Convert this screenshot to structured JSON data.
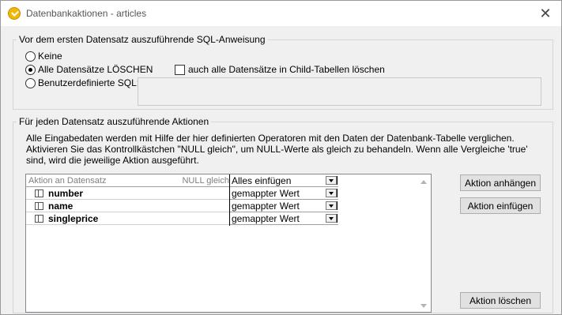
{
  "window": {
    "title": "Datenbankaktionen - articles"
  },
  "sql_group": {
    "legend": "Vor dem ersten Datensatz auszuführende SQL-Anweisung",
    "options": [
      {
        "label": "Keine",
        "checked": false
      },
      {
        "label": "Alle Datensätze LÖSCHEN",
        "checked": true
      },
      {
        "label": "Benutzerdefinierte SQL:",
        "checked": false
      }
    ],
    "child_tables_label": "auch alle Datensätze in Child-Tabellen löschen",
    "child_tables_checked": false,
    "custom_sql_value": ""
  },
  "actions_group": {
    "legend": "Für jeden Datensatz auszuführende Aktionen",
    "description": "Alle Eingabedaten werden mit Hilfe der hier definierten Operatoren mit den Daten der Datenbank-Tabelle verglichen. Aktivieren Sie das Kontrollkästchen \"NULL gleich\", um NULL-Werte als gleich zu behandeln. Wenn alle Vergleiche 'true' sind, wird die jeweilige Aktion ausgeführt.",
    "grid": {
      "header_action": "Aktion an Datensatz",
      "header_null": "NULL gleich",
      "header_combo": "Alles einfügen",
      "rows": [
        {
          "field": "number",
          "mode": "gemappter Wert"
        },
        {
          "field": "name",
          "mode": "gemappter Wert"
        },
        {
          "field": "singleprice",
          "mode": "gemappter Wert"
        }
      ]
    },
    "buttons": {
      "append": "Aktion anhängen",
      "insert": "Aktion einfügen",
      "delete": "Aktion löschen"
    }
  },
  "icons": {
    "app": "altova-checkmark-icon",
    "close": "close-icon",
    "field": "field-icon"
  }
}
